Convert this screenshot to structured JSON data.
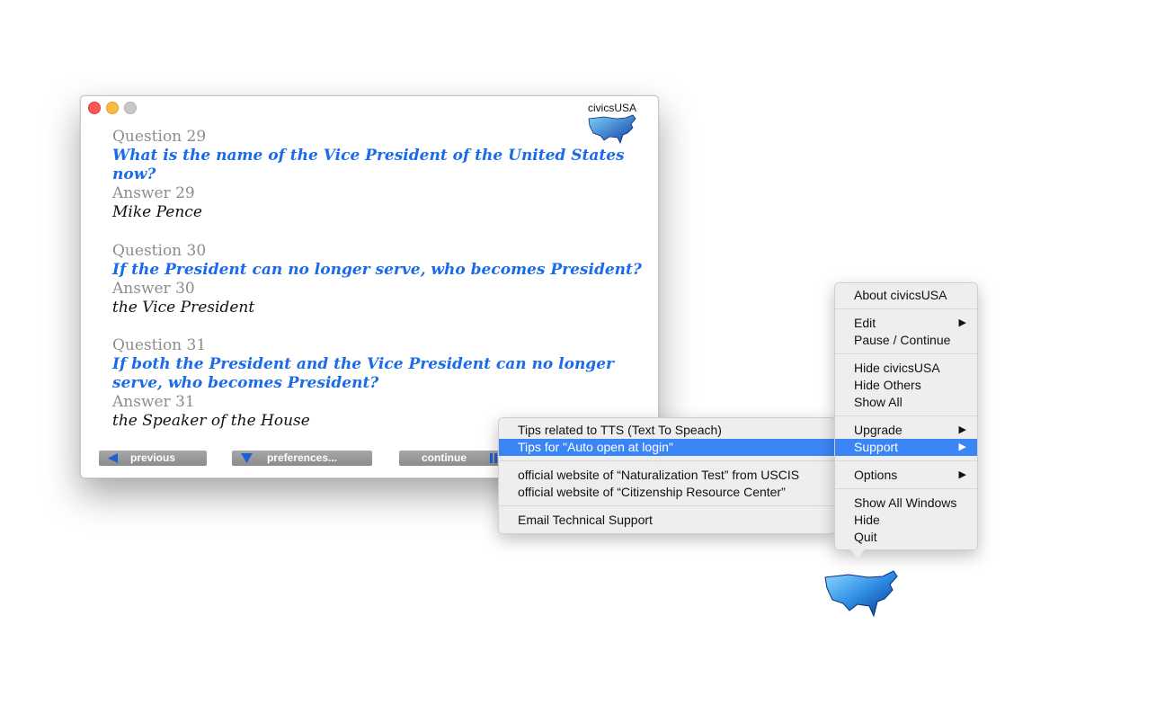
{
  "window": {
    "brand": "civicsUSA",
    "qa": [
      {
        "qnum": "Question 29",
        "question": "What is the name of the Vice President of the United States now?",
        "anum": "Answer 29",
        "answer": "Mike Pence"
      },
      {
        "qnum": "Question 30",
        "question": "If the President can no longer serve, who becomes President?",
        "anum": "Answer 30",
        "answer": "the Vice President"
      },
      {
        "qnum": "Question 31",
        "question": "If both the President and the Vice President can no longer serve, who becomes President?",
        "anum": "Answer 31",
        "answer": "the Speaker of the House"
      }
    ],
    "buttons": {
      "previous": "previous",
      "preferences": "preferences...",
      "continue": "continue"
    }
  },
  "main_menu": {
    "about": "About civicsUSA",
    "edit": "Edit",
    "pause_continue": "Pause / Continue",
    "hide_app": "Hide civicsUSA",
    "hide_others": "Hide Others",
    "show_all": "Show All",
    "upgrade": "Upgrade",
    "support": "Support",
    "options": "Options",
    "show_all_windows": "Show All Windows",
    "hide": "Hide",
    "quit": "Quit",
    "submenu_arrow": "▶"
  },
  "support_menu": {
    "tips_tts": "Tips related to TTS (Text To Speach)",
    "tips_autoopen": "Tips for \"Auto open at login\"",
    "naturalization": "official website of “Naturalization Test” from USCIS",
    "citizenship": "official website of “Citizenship Resource Center”",
    "email_support": "Email Technical Support"
  },
  "colors": {
    "question_blue": "#1a6bea",
    "highlight": "#3b86f7",
    "button_gray": "#999999"
  }
}
